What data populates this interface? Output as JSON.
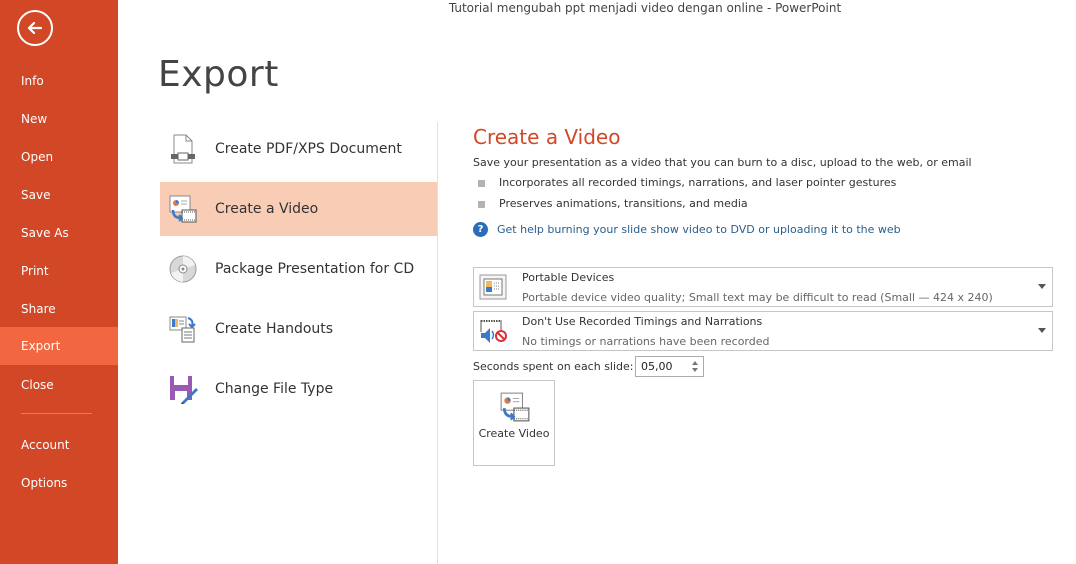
{
  "window": {
    "title": "Tutorial mengubah ppt menjadi video dengan online - PowerPoint"
  },
  "sidebar": {
    "back_icon": "back-arrow-icon",
    "items": [
      {
        "label": "Info",
        "active": false
      },
      {
        "label": "New",
        "active": false
      },
      {
        "label": "Open",
        "active": false
      },
      {
        "label": "Save",
        "active": false
      },
      {
        "label": "Save As",
        "active": false
      },
      {
        "label": "Print",
        "active": false
      },
      {
        "label": "Share",
        "active": false
      },
      {
        "label": "Export",
        "active": true
      },
      {
        "label": "Close",
        "active": false
      }
    ],
    "bottom_items": [
      {
        "label": "Account"
      },
      {
        "label": "Options"
      }
    ],
    "colors": {
      "background": "#d24726",
      "active": "#f26740"
    }
  },
  "page": {
    "title": "Export"
  },
  "export_options": [
    {
      "label": "Create PDF/XPS Document",
      "icon": "pdf-document-icon",
      "active": false
    },
    {
      "label": "Create a Video",
      "icon": "create-video-icon",
      "active": true
    },
    {
      "label": "Package Presentation for CD",
      "icon": "cd-icon",
      "active": false
    },
    {
      "label": "Create Handouts",
      "icon": "handouts-icon",
      "active": false
    },
    {
      "label": "Change File Type",
      "icon": "change-file-type-icon",
      "active": false
    }
  ],
  "panel": {
    "title": "Create a Video",
    "description": "Save your presentation as a video that you can burn to a disc, upload to the web, or email",
    "bullets": [
      "Incorporates all recorded timings, narrations, and laser pointer gestures",
      "Preserves animations, transitions, and media"
    ],
    "help_link": "Get help burning your slide show video to DVD or uploading it to the web",
    "quality_dropdown": {
      "selected": "Portable Devices",
      "description": "Portable device video quality; Small text may be difficult to read  (Small — 424 x 240)"
    },
    "timings_dropdown": {
      "selected": "Don't Use Recorded Timings and Narrations",
      "description": "No timings or narrations have been recorded"
    },
    "seconds_label": "Seconds spent on each slide:",
    "seconds_value": "05,00",
    "create_button_label": "Create Video",
    "accent_color": "#d24726",
    "link_color": "#2a5e8c"
  }
}
